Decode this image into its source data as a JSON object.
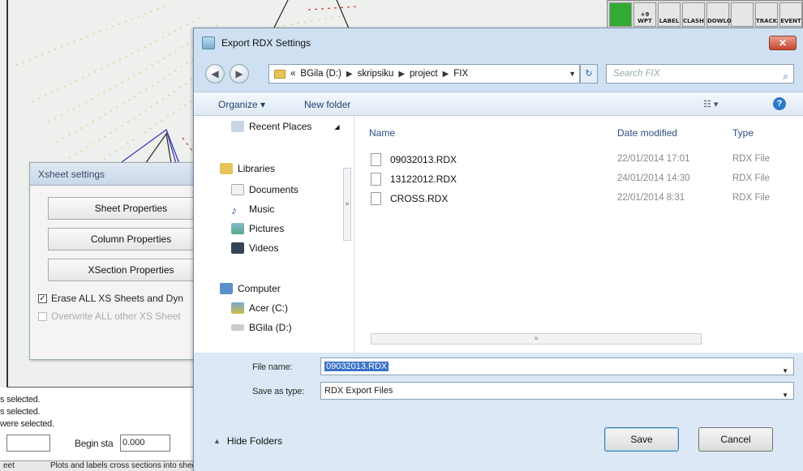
{
  "cad": {
    "toolbar": [
      "",
      "+9 WPT",
      "LABEL",
      "CLASH",
      "DOWLOAD",
      "",
      "TRACK",
      "EVENT"
    ],
    "statusbar": "Plots and labels cross sections into sheets",
    "statusbar_left": "eet",
    "messages": [
      "s selected.",
      "s selected.",
      "were selected."
    ],
    "begin_label": "Begin sta",
    "begin_value": "0.000"
  },
  "xsheet": {
    "title": "Xsheet settings",
    "buttons": [
      "Sheet Properties",
      "Column Properties",
      "XSection Properties"
    ],
    "check1": "Erase ALL XS Sheets and Dyn",
    "check2": "Overwrite ALL other XS Sheet"
  },
  "dialog": {
    "title": "Export RDX Settings",
    "close": "✕",
    "breadcrumb": [
      "«",
      "BGila (D:)",
      "skripsiku",
      "project",
      "FIX"
    ],
    "search_placeholder": "Search FIX",
    "organize": "Organize ▾",
    "new_folder": "New folder",
    "nav": [
      {
        "label": "Recent Places"
      },
      {
        "label": "Libraries"
      },
      {
        "label": "Documents"
      },
      {
        "label": "Music"
      },
      {
        "label": "Pictures"
      },
      {
        "label": "Videos"
      },
      {
        "label": "Computer"
      },
      {
        "label": "Acer (C:)"
      },
      {
        "label": "BGila (D:)"
      }
    ],
    "columns": {
      "name": "Name",
      "date": "Date modified",
      "type": "Type"
    },
    "files": [
      {
        "name": "09032013.RDX",
        "date": "22/01/2014 17:01",
        "type": "RDX File"
      },
      {
        "name": "13122012.RDX",
        "date": "24/01/2014 14:30",
        "type": "RDX File"
      },
      {
        "name": "CROSS.RDX",
        "date": "22/01/2014 8:31",
        "type": "RDX File"
      }
    ],
    "file_name_label": "File name:",
    "file_name_value": "09032013.RDX",
    "save_type_label": "Save as type:",
    "save_type_value": "RDX Export Files",
    "hide_folders": "Hide Folders",
    "save": "Save",
    "cancel": "Cancel"
  }
}
